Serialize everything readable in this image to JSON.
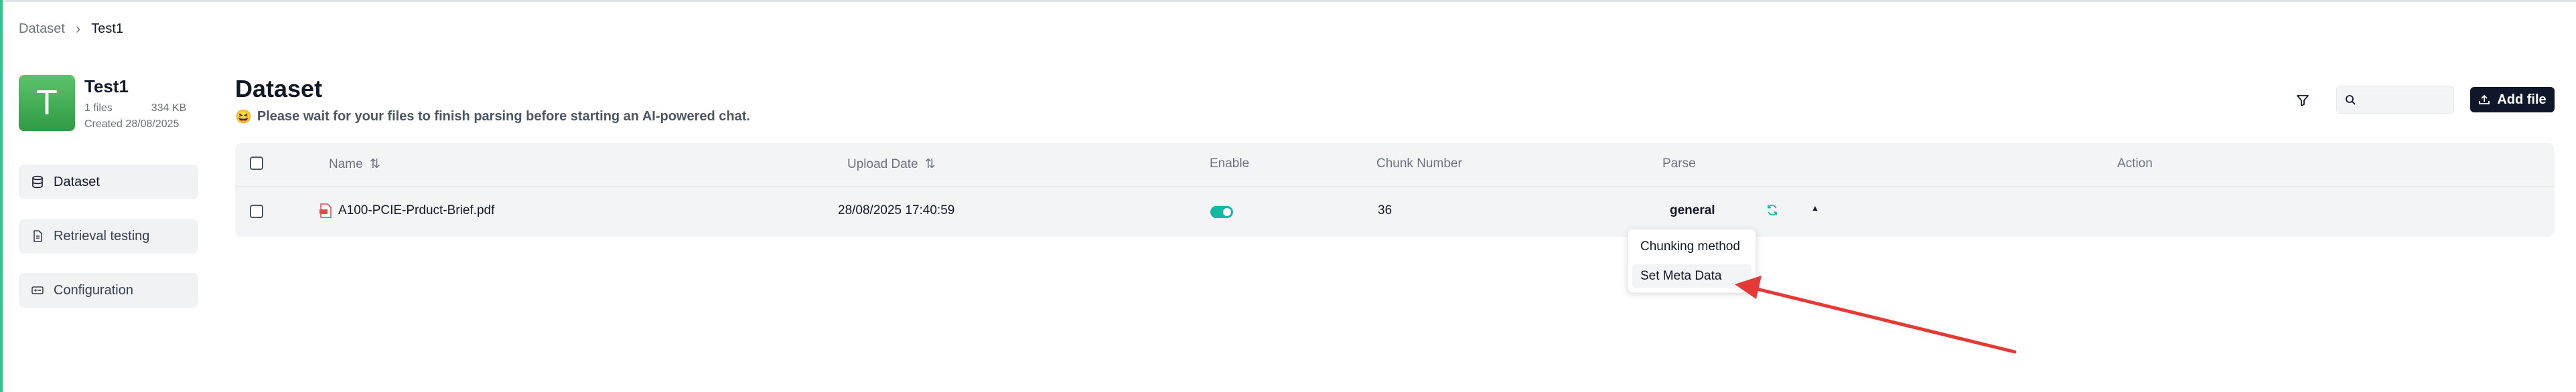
{
  "breadcrumb": {
    "parent": "Dataset",
    "current": "Test1"
  },
  "kb": {
    "avatar_letter": "T",
    "name": "Test1",
    "files": "1 files",
    "size": "334 KB",
    "created": "Created 28/08/2025"
  },
  "sidebar": {
    "items": [
      {
        "label": "Dataset",
        "icon": "database-icon",
        "active": true
      },
      {
        "label": "Retrieval testing",
        "icon": "document-icon",
        "active": false
      },
      {
        "label": "Configuration",
        "icon": "config-icon",
        "active": false
      }
    ]
  },
  "main": {
    "title": "Dataset",
    "notice_emoji": "😆",
    "notice": "Please wait for your files to finish parsing before starting an AI-powered chat."
  },
  "toolbar": {
    "search_placeholder": "",
    "add_file_label": "Add file"
  },
  "table": {
    "columns": {
      "name": "Name",
      "upload_date": "Upload Date",
      "enable": "Enable",
      "chunk_number": "Chunk Number",
      "parse": "Parse",
      "action": "Action"
    },
    "rows": [
      {
        "name": "A100-PCIE-Prduct-Brief.pdf",
        "upload_date": "28/08/2025 17:40:59",
        "enabled": true,
        "chunk_number": "36",
        "parse": "general"
      }
    ]
  },
  "dropdown": {
    "items": [
      {
        "label": "Chunking method"
      },
      {
        "label": "Set Meta Data"
      }
    ]
  },
  "colors": {
    "accent": "#14b8a6",
    "primary_button": "#0f172a",
    "annotation_arrow": "#e53935"
  }
}
